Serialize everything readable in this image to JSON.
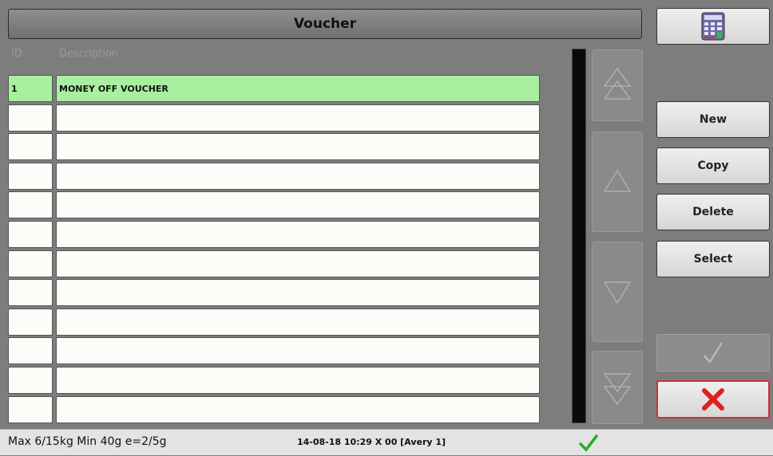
{
  "title": "Voucher",
  "columns": {
    "id": "ID",
    "description": "Description"
  },
  "rows": [
    {
      "id": "1",
      "description": "MONEY OFF VOUCHER",
      "selected": true
    },
    {
      "id": "",
      "description": ""
    },
    {
      "id": "",
      "description": ""
    },
    {
      "id": "",
      "description": ""
    },
    {
      "id": "",
      "description": ""
    },
    {
      "id": "",
      "description": ""
    },
    {
      "id": "",
      "description": ""
    },
    {
      "id": "",
      "description": ""
    },
    {
      "id": "",
      "description": ""
    },
    {
      "id": "",
      "description": ""
    },
    {
      "id": "",
      "description": ""
    },
    {
      "id": "",
      "description": ""
    }
  ],
  "buttons": {
    "keypad_icon": "keypad-icon",
    "new": "New",
    "copy": "Copy",
    "delete": "Delete",
    "select": "Select",
    "confirm_icon": "check-icon",
    "cancel_icon": "close-icon"
  },
  "scroll": {
    "page_up_icon": "double-up-arrow-icon",
    "up_icon": "up-arrow-icon",
    "down_icon": "down-arrow-icon",
    "page_down_icon": "double-down-arrow-icon"
  },
  "status": {
    "scale_info": "Max 6/15kg Min 40g e=2/5g",
    "datetime_info": "14-08-18 10:29 X 00 [Avery 1]",
    "ok_icon": "green-check-icon"
  },
  "colors": {
    "selected_row": "#a8f0a0",
    "cancel": "#e02020",
    "ok_check": "#22b022"
  }
}
